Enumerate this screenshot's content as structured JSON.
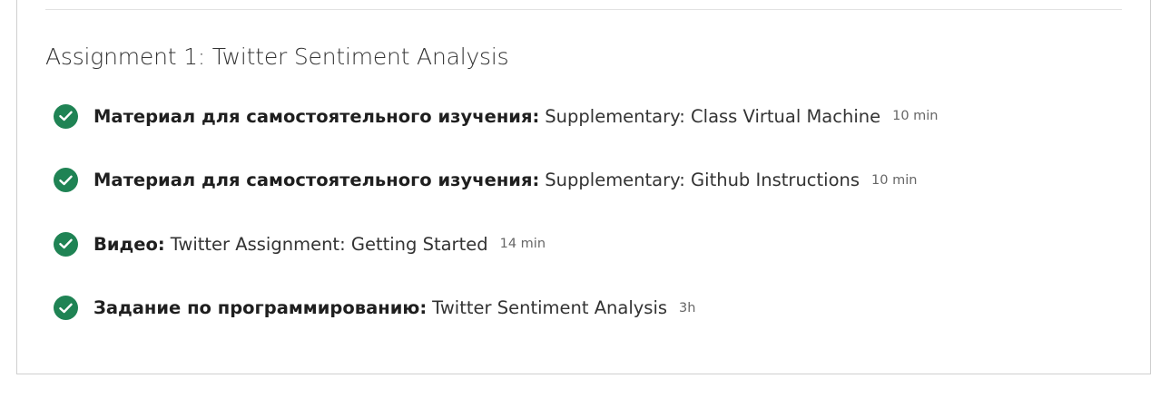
{
  "section": {
    "title": "Assignment 1: Twitter Sentiment Analysis"
  },
  "items": [
    {
      "type": "Материал для самостоятельного изучения:",
      "title": "Supplementary: Class Virtual Machine",
      "duration": "10 min",
      "completed": true
    },
    {
      "type": "Материал для самостоятельного изучения:",
      "title": "Supplementary: Github Instructions",
      "duration": "10 min",
      "completed": true
    },
    {
      "type": "Видео:",
      "title": "Twitter Assignment: Getting Started",
      "duration": "14 min",
      "completed": true
    },
    {
      "type": "Задание по программированию:",
      "title": "Twitter Sentiment Analysis",
      "duration": "3h",
      "completed": true
    }
  ],
  "icons": {
    "status": "check-circle-icon"
  },
  "colors": {
    "completed_green": "#1f8354",
    "text_dark": "#1f1f1f",
    "text_muted": "#666666",
    "border": "#cfcfcf"
  }
}
